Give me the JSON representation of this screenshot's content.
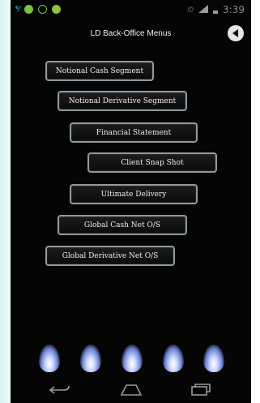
{
  "status_bar": {
    "time": "3:39",
    "notification_icons": [
      "signal-bars-icon",
      "app-icon",
      "whatsapp-icon",
      "app-icon"
    ],
    "system_icons": [
      "alarm-icon",
      "cell-signal-icon",
      "battery-icon"
    ]
  },
  "header": {
    "title": "LD Back-Office Menus",
    "back_icon": "back-arrow-icon"
  },
  "menu": {
    "items": [
      {
        "label": "Notional Cash Segment"
      },
      {
        "label": "Notional Derivative Segment"
      },
      {
        "label": "Financial Statement"
      },
      {
        "label": "Client Snap Shot"
      },
      {
        "label": "Ultimate Delivery"
      },
      {
        "label": "Global Cash Net O/S"
      },
      {
        "label": "Global Derivative Net O/S"
      }
    ]
  },
  "nav_bar": {
    "icons": [
      "back-nav-icon",
      "home-nav-icon",
      "recent-apps-nav-icon"
    ]
  },
  "colors": {
    "background": "#050505",
    "button_border": "#8f9aa0",
    "flame_glow": "#6f84d4"
  }
}
